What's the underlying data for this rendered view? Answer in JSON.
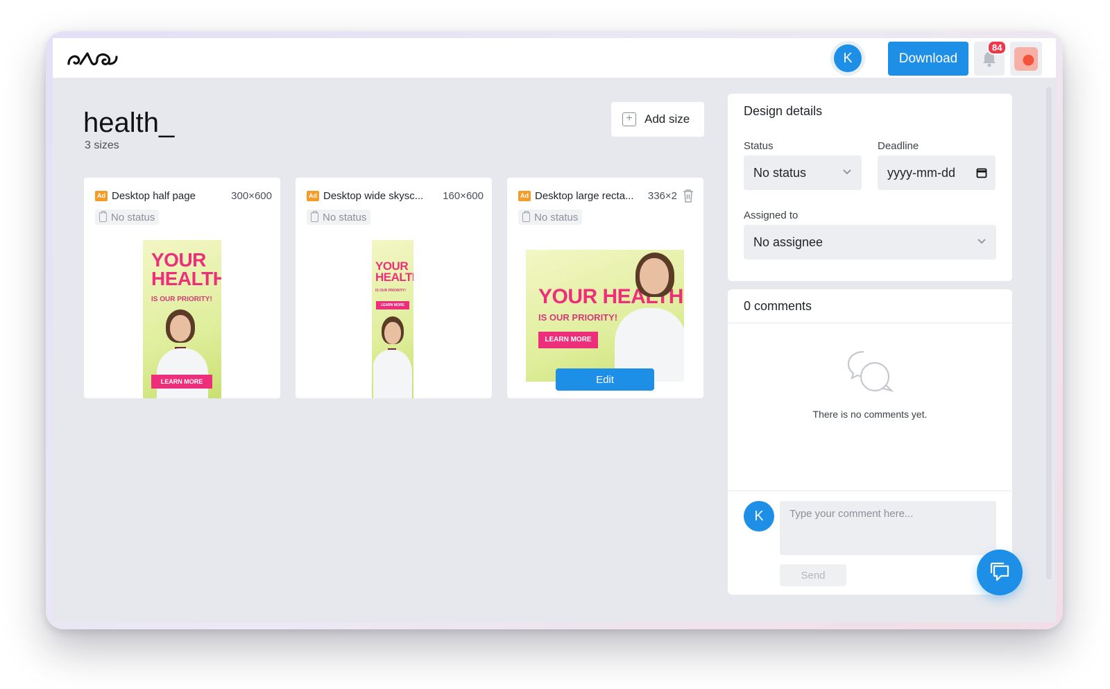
{
  "header": {
    "logo_icon": "brand-logo",
    "avatar_initial": "K",
    "download_label": "Download",
    "notification_count": "84",
    "bell_icon": "bell-icon"
  },
  "project": {
    "title": "health_",
    "size_count": "3 sizes",
    "add_size_label": "Add size"
  },
  "cards": [
    {
      "name": "Desktop half page",
      "size": "300×600",
      "status": "No status",
      "creative": {
        "headline_1": "YOUR",
        "headline_2": "HEALTH",
        "tagline": "IS OUR PRIORITY!",
        "cta": "LEARN MORE"
      }
    },
    {
      "name": "Desktop wide skysc...",
      "size": "160×600",
      "status": "No status",
      "creative": {
        "headline_1": "YOUR",
        "headline_2": "HEALTH",
        "tagline": "IS OUR PRIORITY!",
        "cta": "LEARN MORE"
      }
    },
    {
      "name": "Desktop large recta...",
      "size": "336×2",
      "status": "No status",
      "edit_label": "Edit",
      "creative": {
        "headline_1": "YOUR HEALTH",
        "tagline": "IS OUR PRIORITY!",
        "cta": "LEARN MORE"
      }
    }
  ],
  "design_details": {
    "title": "Design details",
    "status_label": "Status",
    "status_value": "No status",
    "deadline_label": "Deadline",
    "deadline_placeholder": "yyyy-mm-dd",
    "assigned_label": "Assigned to",
    "assigned_value": "No assignee"
  },
  "comments": {
    "title": "0 comments",
    "empty_text": "There is no comments yet.",
    "avatar_initial": "K",
    "input_placeholder": "Type your comment here...",
    "send_label": "Send"
  },
  "colors": {
    "primary": "#1e8fe6",
    "ad_badge": "#f59b28",
    "badge_red": "#f0384d",
    "creative_pink": "#ec2e7b",
    "creative_green": "#dfee9c"
  }
}
